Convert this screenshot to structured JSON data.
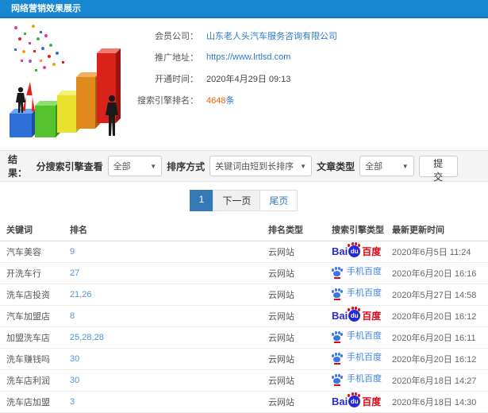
{
  "header": {
    "title": "网络营销效果展示"
  },
  "info": {
    "rows": [
      {
        "label": "会员公司：",
        "value": "山东老人头汽车服务咨询有限公司"
      },
      {
        "label": "推广地址：",
        "value": "https://www.lrtlsd.com"
      },
      {
        "label": "开通时间：",
        "value": "2020年4月29日 09:13"
      },
      {
        "label": "搜索引擎排名：",
        "value": "4648",
        "suffix": "条"
      }
    ]
  },
  "filters": {
    "result_label": "结果：",
    "engine_label": "分搜索引擎查看",
    "engine_value": "全部",
    "sort_label": "排序方式",
    "sort_value": "关键词由短到长排序",
    "article_label": "文章类型",
    "article_value": "全部",
    "submit_label": "提交"
  },
  "pagination": {
    "current": "1",
    "next": "下一页",
    "last": "尾页"
  },
  "baidu": {
    "pc_bai": "Bai",
    "pc_du": "du",
    "pc_hanzi": "百度",
    "mobile_label": "手机百度"
  },
  "table": {
    "headers": [
      "关键词",
      "排名",
      "排名类型",
      "搜索引擎类型",
      "最新更新时间"
    ],
    "rows": [
      {
        "keyword": "汽车美容",
        "rank": "9",
        "rank_type": "云网站",
        "engine": "baidu-pc",
        "updated": "2020年6月5日 11:24"
      },
      {
        "keyword": "开洗车行",
        "rank": "27",
        "rank_type": "云网站",
        "engine": "baidu-mobile",
        "updated": "2020年6月20日 16:16"
      },
      {
        "keyword": "洗车店投资",
        "rank": "21,26",
        "rank_type": "云网站",
        "engine": "baidu-mobile",
        "updated": "2020年5月27日 14:58"
      },
      {
        "keyword": "汽车加盟店",
        "rank": "8",
        "rank_type": "云网站",
        "engine": "baidu-pc",
        "updated": "2020年6月20日 16:12"
      },
      {
        "keyword": "加盟洗车店",
        "rank": "25,28,28",
        "rank_type": "云网站",
        "engine": "baidu-mobile",
        "updated": "2020年6月20日 16:11"
      },
      {
        "keyword": "洗车赚钱吗",
        "rank": "30",
        "rank_type": "云网站",
        "engine": "baidu-mobile",
        "updated": "2020年6月20日 16:12"
      },
      {
        "keyword": "洗车店利润",
        "rank": "30",
        "rank_type": "云网站",
        "engine": "baidu-mobile",
        "updated": "2020年6月18日 14:27"
      },
      {
        "keyword": "洗车店加盟",
        "rank": "3",
        "rank_type": "云网站",
        "engine": "baidu-pc",
        "updated": "2020年6月18日 14:30"
      }
    ]
  },
  "colors": {
    "header_bg": "#1687d0",
    "link_blue": "#2a7cc9",
    "rank_blue": "#4f94d8",
    "highlight_orange": "#ff5a00",
    "pagination_active": "#337ab7",
    "baidu_blue": "#2628d9",
    "baidu_red": "#e60012"
  }
}
